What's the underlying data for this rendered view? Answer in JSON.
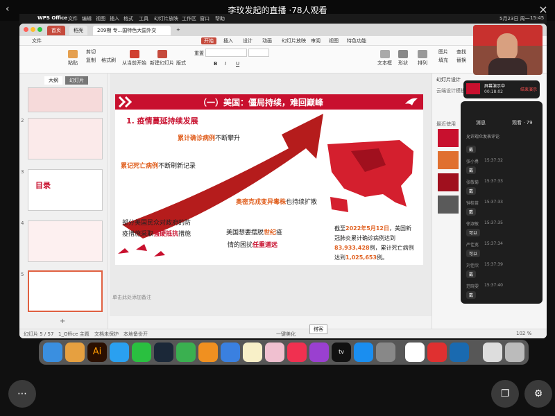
{
  "stream": {
    "title": "李玟发起的直播",
    "viewers": "·78人观看"
  },
  "macbar": {
    "app": "WPS Office",
    "menus": [
      "文件",
      "编辑",
      "视图",
      "插入",
      "格式",
      "工具",
      "幻灯片放映",
      "工作区",
      "窗口",
      "帮助"
    ],
    "date": "5月23日 周一",
    "time": "15:45"
  },
  "tabs": {
    "home": "首页",
    "template": "稻壳",
    "doc": "209期 专...国特色大国外交",
    "plus": "+"
  },
  "ribbon_tabs": [
    "文件",
    "开始",
    "插入",
    "设计",
    "动画",
    "幻灯片放映",
    "审阅",
    "视图",
    "特色功能"
  ],
  "ribbon": {
    "paste": "粘贴",
    "cut": "剪切",
    "copy": "复制",
    "format": "格式刷",
    "from_start": "从当前开始",
    "new_slide": "新建幻灯片",
    "layout": "版式",
    "reset": "重置",
    "textbox": "文本框",
    "shape": "形状",
    "arrange": "排列",
    "picture": "图片",
    "fill": "填充",
    "find": "查找",
    "replace": "替换"
  },
  "leftpanel": {
    "tab_outline": "大纲",
    "tab_slides": "幻灯片",
    "slide_numbers": [
      "2",
      "3",
      "4",
      "5"
    ],
    "thumb4_title": "目录"
  },
  "slide": {
    "header": "（一）美国：僵局持续，难回巅峰",
    "subtitle": "1. 疫情蔓延持续发展",
    "t1_red": "累计确诊病例",
    "t1_rest": "不断攀升",
    "t2_red": "累记死亡病例",
    "t2_rest": "不断刷新记录",
    "t3_red": "奥密克戎变异毒株",
    "t3_rest": "也持续扩散",
    "t4a": "部分美国民众对政府的防",
    "t4b_pre": "疫措施采取",
    "t4b_red": "强硬抵抗",
    "t4b_post": "措施",
    "t5a_pre": "美国想要摆脱",
    "t5a_red": "世纪",
    "t5a_post": "疫",
    "t5b_pre": "情的困扰",
    "t5b_red": "任重道远",
    "stat1_pre": "截至",
    "stat1_date": "2022年5月12日",
    "stat1_post": "，美国新",
    "stat2": "冠肺炎累计确诊病例达到",
    "stat3_num": "83,933,428",
    "stat3_post": "例，累计死亡病例",
    "stat4_pre": "达到",
    "stat4_num": "1,025,653",
    "stat4_post": "例。"
  },
  "notes": "单击此处添加备注",
  "rightpanel": {
    "title": "幻灯片设计",
    "subtitle": "云端设计模板",
    "recent": "最近使用"
  },
  "chat": {
    "header": "屏幕演示中",
    "timer": "00:18:02",
    "stop": "结束演示",
    "tab_msgs": "消息",
    "tab_viewers": "观看 · 79",
    "comment_allow": "允许观众发表评论",
    "entries": [
      {
        "name": "",
        "time": "",
        "msg": "戴"
      },
      {
        "name": "张小勇",
        "time": "15:37:32",
        "msg": "戴"
      },
      {
        "name": "张敬菊",
        "time": "15:37:33",
        "msg": "戴"
      },
      {
        "name": "钟桂苗",
        "time": "15:37:33",
        "msg": "戴"
      },
      {
        "name": "徐淑敏",
        "time": "15:37:35",
        "msg": "可以"
      },
      {
        "name": "严佳宽",
        "time": "15:37:34",
        "msg": "可以"
      },
      {
        "name": "刘佳欣",
        "time": "15:37:39",
        "msg": "戴"
      },
      {
        "name": "范晓雯",
        "time": "15:37:40",
        "msg": "戴"
      }
    ]
  },
  "statusbar": {
    "page": "幻灯片 5 / 57",
    "theme": "1_Office 主题",
    "protect": "文档未保护",
    "cloud": "本地备份开",
    "beautify": "一键美化",
    "zoom": "102 %",
    "tooltip": "搭客"
  }
}
